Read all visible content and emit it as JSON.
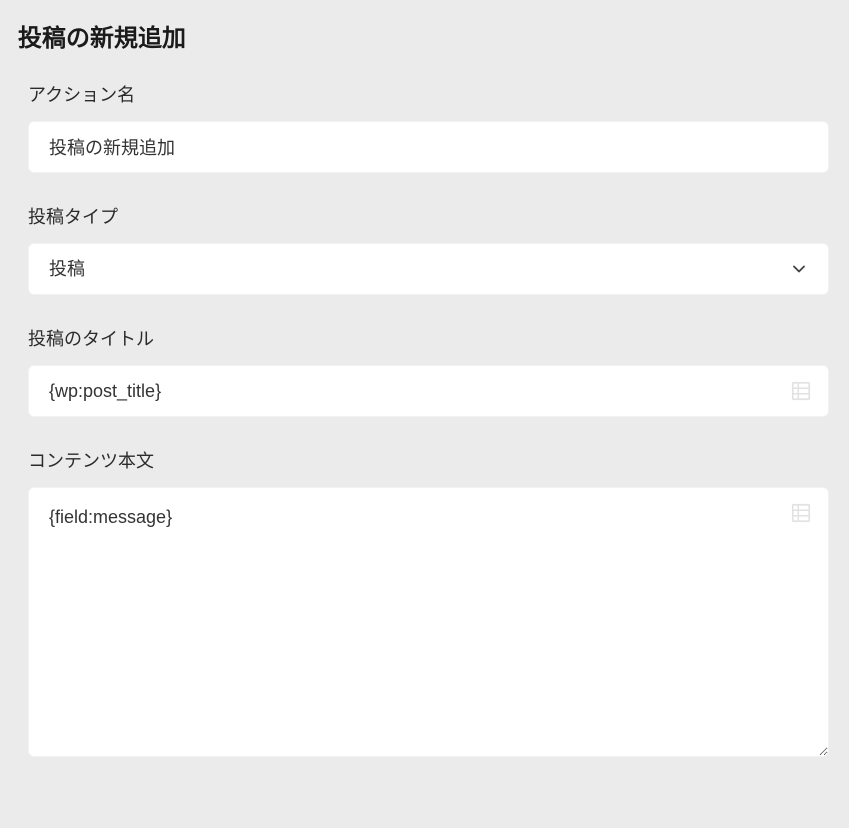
{
  "page": {
    "title": "投稿の新規追加"
  },
  "fields": {
    "action_name": {
      "label": "アクション名",
      "value": "投稿の新規追加"
    },
    "post_type": {
      "label": "投稿タイプ",
      "selected": "投稿"
    },
    "post_title": {
      "label": "投稿のタイトル",
      "value": "{wp:post_title}"
    },
    "content_body": {
      "label": "コンテンツ本文",
      "value": "{field:message}"
    }
  }
}
